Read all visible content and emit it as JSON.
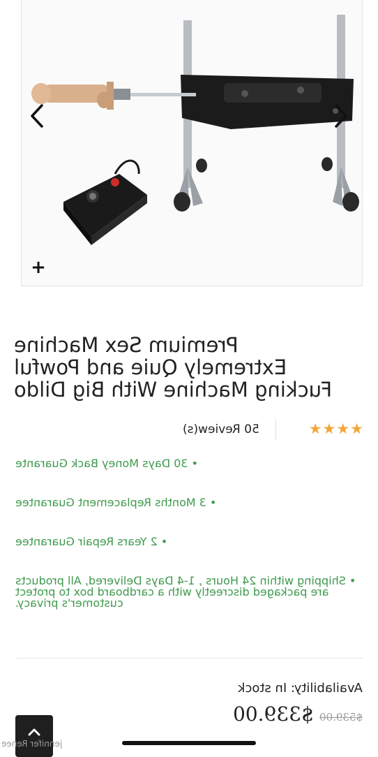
{
  "product": {
    "title_lines": [
      "Premium Sex Machine",
      "Extremely Quie and Powful",
      "Fucking Machine With Big Dildo"
    ],
    "rating_stars": 4,
    "star_glyphs": "★★★★",
    "reviews_label": "50 Review(s)",
    "features": [
      "• 30 Days Money Back Guarante",
      "• 3 Months Replacement Guarantee",
      "• 2 Years Repair Guarantee",
      "• Shipping within 24 Hours , 1-4 Days Delivered, All products are packaged discreetly with a cardboard box to protect customer's privacy."
    ],
    "availability_label": "Availability:",
    "availability_value": "In stock",
    "old_price": "$539.00",
    "new_price": "$339.00"
  },
  "watermark": "jennifer Renee",
  "colors": {
    "accent_green": "#3f9a4e",
    "star": "#f2a73b",
    "dark_button": "#1f1f1f"
  },
  "icons": {
    "prev": "chevron-left-icon",
    "next": "chevron-right-icon",
    "zoom": "plus-icon",
    "back_to_top": "chevron-up-icon"
  }
}
